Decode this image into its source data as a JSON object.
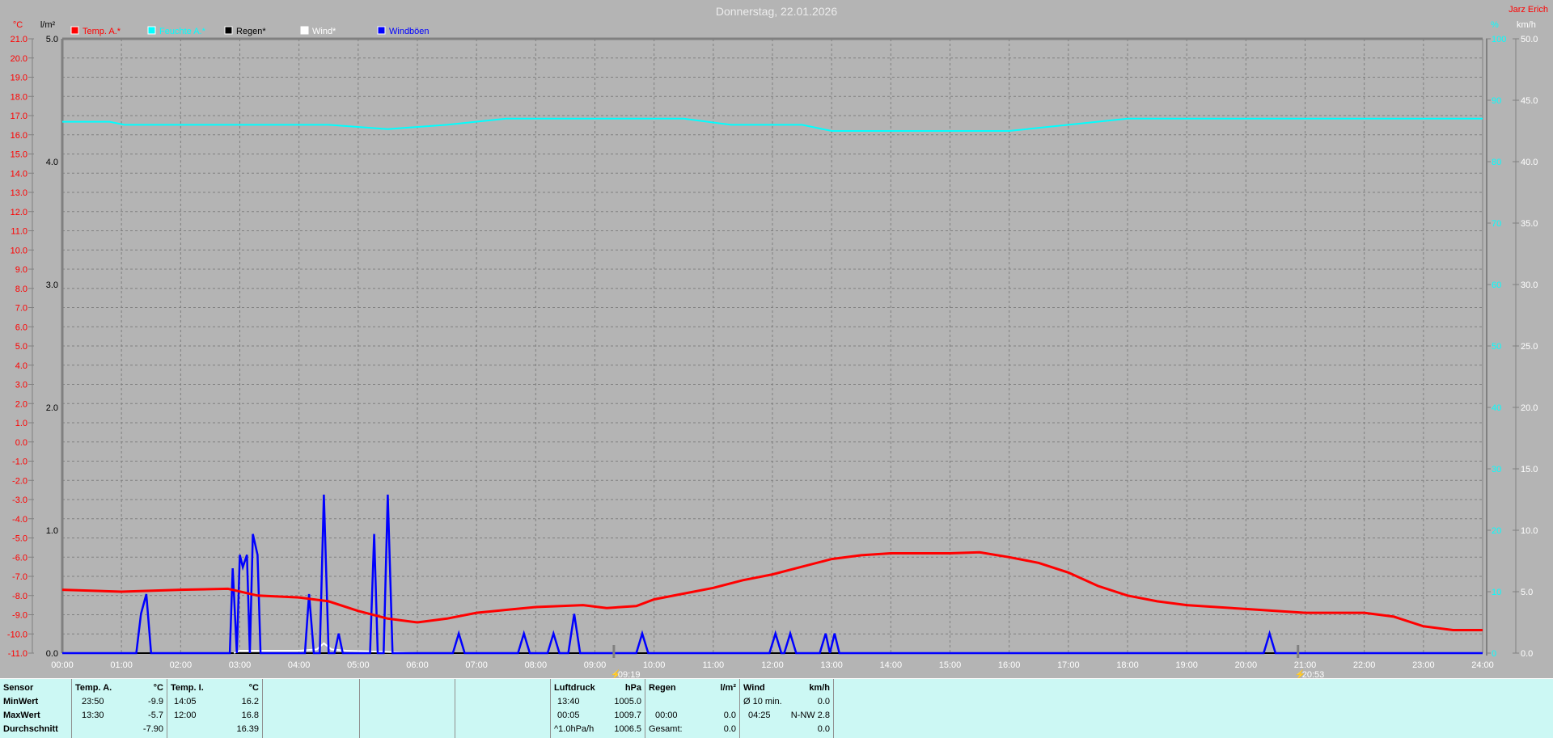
{
  "title": "Donnerstag, 22.01.2026",
  "author": "Jarz Erich",
  "colors": {
    "temp": "#ff0000",
    "humidity": "#00ffff",
    "rain": "#000000",
    "wind": "#ffffff",
    "gust": "#0000ff"
  },
  "chart_data": {
    "type": "line",
    "title": "Donnerstag, 22.01.2026",
    "xlabel": "",
    "x_ticks": [
      "00:00",
      "01:00",
      "02:00",
      "03:00",
      "04:00",
      "05:00",
      "06:00",
      "07:00",
      "08:00",
      "09:00",
      "10:00",
      "11:00",
      "12:00",
      "13:00",
      "14:00",
      "15:00",
      "16:00",
      "17:00",
      "18:00",
      "19:00",
      "20:00",
      "21:00",
      "22:00",
      "23:00",
      "24:00"
    ],
    "xlim": [
      0,
      24
    ],
    "grid": true,
    "legend_position": "top-left",
    "axes": {
      "temp": {
        "label": "°C",
        "ylim": [
          -11,
          21
        ],
        "step": 1
      },
      "rain": {
        "label": "l/m²",
        "ylim": [
          0,
          5
        ],
        "step": 1
      },
      "humidity": {
        "label": "%",
        "ylim": [
          0,
          100
        ],
        "step": 10
      },
      "wind": {
        "label": "km/h",
        "ylim": [
          0,
          50
        ],
        "step": 5
      }
    },
    "markers": [
      {
        "label": "09:19",
        "x": 9.32,
        "kind": "sunrise"
      },
      {
        "label": "20:53",
        "x": 20.88,
        "kind": "sunset"
      }
    ],
    "series": [
      {
        "name": "Temp. A.*",
        "axis": "temp",
        "color": "#ff0000",
        "x": [
          0,
          1,
          2,
          2.8,
          3.3,
          4,
          4.5,
          5,
          5.5,
          6,
          6.5,
          7,
          8,
          8.8,
          9.2,
          9.7,
          10,
          10.5,
          11,
          11.5,
          12,
          12.5,
          13,
          13.5,
          14,
          15,
          15.5,
          16,
          16.5,
          17,
          17.5,
          18,
          18.5,
          19,
          19.5,
          20,
          20.5,
          21,
          21.5,
          22,
          22.5,
          23,
          23.5,
          24
        ],
        "y": [
          -7.7,
          -7.8,
          -7.7,
          -7.65,
          -8.0,
          -8.1,
          -8.3,
          -8.8,
          -9.2,
          -9.4,
          -9.2,
          -8.9,
          -8.6,
          -8.5,
          -8.65,
          -8.55,
          -8.2,
          -7.9,
          -7.6,
          -7.2,
          -6.9,
          -6.5,
          -6.1,
          -5.9,
          -5.8,
          -5.8,
          -5.75,
          -6.0,
          -6.3,
          -6.8,
          -7.5,
          -8.0,
          -8.3,
          -8.5,
          -8.6,
          -8.7,
          -8.8,
          -8.9,
          -8.9,
          -8.9,
          -9.1,
          -9.6,
          -9.8,
          -9.8
        ]
      },
      {
        "name": "Feuchte A.*",
        "axis": "humidity",
        "color": "#00ffff",
        "x": [
          0,
          0.8,
          1.05,
          4.5,
          5.5,
          6.5,
          7.5,
          10.5,
          11.3,
          12.5,
          13,
          16,
          17,
          18,
          24
        ],
        "y": [
          86.5,
          86.5,
          86,
          86,
          85.3,
          86,
          87,
          87,
          86,
          86,
          85,
          85,
          86,
          87,
          87
        ]
      },
      {
        "name": "Regen*",
        "axis": "rain",
        "color": "#000000",
        "x": [
          0,
          24
        ],
        "y": [
          0,
          0
        ]
      },
      {
        "name": "Wind*",
        "axis": "wind",
        "color": "#ffffff",
        "x": [
          2.9,
          3.0,
          3.4,
          4.0,
          4.3,
          4.42,
          4.55,
          4.8,
          5.5,
          6.0
        ],
        "y": [
          0,
          0.2,
          0.2,
          0.2,
          0.3,
          0.8,
          0.3,
          0.2,
          0.1,
          0
        ]
      },
      {
        "name": "Windböen",
        "axis": "wind",
        "color": "#0000ff",
        "x": [
          0,
          1.25,
          1.33,
          1.42,
          1.5,
          2.83,
          2.88,
          2.95,
          3.0,
          3.05,
          3.12,
          3.17,
          3.22,
          3.3,
          3.35,
          4.1,
          4.17,
          4.25,
          4.35,
          4.42,
          4.5,
          4.6,
          4.67,
          4.74,
          5.2,
          5.27,
          5.33,
          5.43,
          5.5,
          5.58,
          6.6,
          6.7,
          6.8,
          7.7,
          7.8,
          7.9,
          8.2,
          8.3,
          8.4,
          8.55,
          8.65,
          8.75,
          9.7,
          9.8,
          9.9,
          11.95,
          12.05,
          12.15,
          12.2,
          12.3,
          12.4,
          12.8,
          12.9,
          12.97,
          13.05,
          13.13,
          20.3,
          20.4,
          20.5,
          24
        ],
        "y": [
          0,
          0,
          3.2,
          4.8,
          0,
          0,
          6.9,
          0,
          8.0,
          7.0,
          8.0,
          0,
          9.7,
          8.0,
          0,
          0,
          4.8,
          0,
          0,
          12.9,
          0,
          0,
          1.6,
          0,
          0,
          9.7,
          0,
          0,
          12.9,
          0,
          0,
          1.6,
          0,
          0,
          1.6,
          0,
          0,
          1.6,
          0,
          0,
          3.2,
          0,
          0,
          1.6,
          0,
          0,
          1.6,
          0,
          0,
          1.6,
          0,
          0,
          1.6,
          0,
          1.6,
          0,
          0,
          1.6,
          0,
          0
        ]
      }
    ]
  },
  "table": {
    "sensor": {
      "header": "Sensor",
      "rows": [
        "MinWert",
        "MaxWert",
        "Durchschnitt"
      ]
    },
    "temp_a": {
      "header": "Temp. A.",
      "unit": "°C",
      "min_time": "23:50",
      "min": "-9.9",
      "max_time": "13:30",
      "max": "-5.7",
      "avg": "-7.90"
    },
    "temp_i": {
      "header": "Temp. I.",
      "unit": "°C",
      "min_time": "14:05",
      "min": "16.2",
      "max_time": "12:00",
      "max": "16.8",
      "avg": "16.39"
    },
    "pressure": {
      "header": "Luftdruck",
      "unit": "hPa",
      "min_time": "13:40",
      "min": "1005.0",
      "max_time": "00:05",
      "max": "1009.7",
      "trend": "^1.0hPa/h",
      "avg": "1006.5"
    },
    "rain": {
      "header": "Regen",
      "unit": "l/m²",
      "max_time": "00:00",
      "max": "0.0",
      "total_label": "Gesamt:",
      "total": "0.0"
    },
    "wind": {
      "header": "Wind",
      "unit": "km/h",
      "avg_label": "Ø 10 min.",
      "avg": "0.0",
      "max_time": "04:25",
      "max": "N-NW 2.8",
      "last": "0.0"
    }
  }
}
